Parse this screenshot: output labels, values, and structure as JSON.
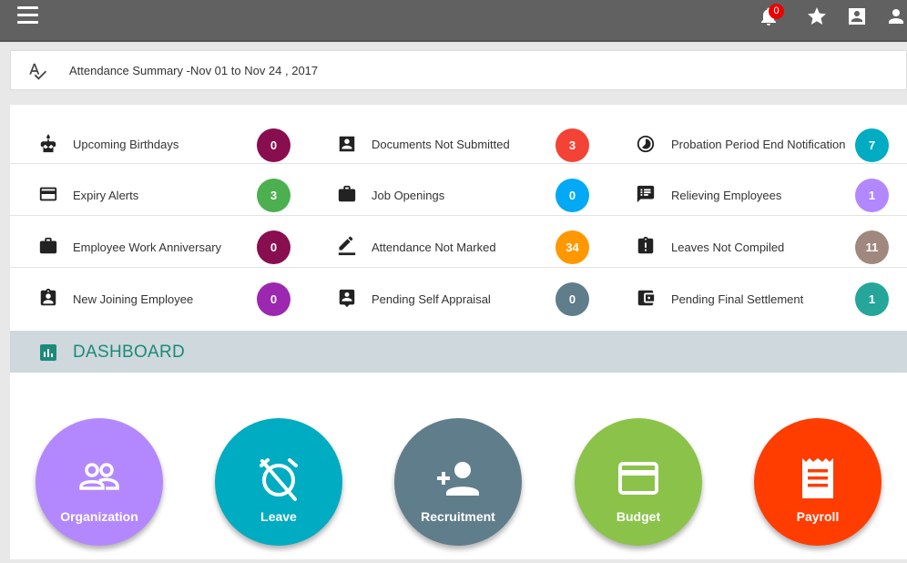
{
  "header": {
    "notification_count": "0",
    "icons": [
      "menu-icon",
      "bell-icon",
      "star-icon",
      "contact-card-icon",
      "user-icon"
    ]
  },
  "summary": {
    "title": "Attendance Summary -Nov 01 to Nov 24 , 2017",
    "icon": "spellcheck-icon"
  },
  "alerts": {
    "rows": [
      [
        {
          "label": "Upcoming Birthdays",
          "count": "0",
          "color": "#880e4f",
          "icon": "cake-icon"
        },
        {
          "label": "Documents Not Submitted",
          "count": "3",
          "color": "#f44336",
          "icon": "id-card-icon"
        },
        {
          "label": "Probation Period End Notification",
          "count": "7",
          "color": "#00acc1",
          "icon": "timelapse-icon"
        }
      ],
      [
        {
          "label": "Expiry Alerts",
          "count": "3",
          "color": "#4caf50",
          "icon": "credit-card-icon"
        },
        {
          "label": "Job Openings",
          "count": "0",
          "color": "#03a9f4",
          "icon": "briefcase-icon"
        },
        {
          "label": "Relieving Employees",
          "count": "1",
          "color": "#b388ff",
          "icon": "message-list-icon"
        }
      ],
      [
        {
          "label": "Employee Work Anniversary",
          "count": "0",
          "color": "#880e4f",
          "icon": "briefcase-icon"
        },
        {
          "label": "Attendance Not Marked",
          "count": "34",
          "color": "#ff9800",
          "icon": "edit-icon"
        },
        {
          "label": "Leaves Not Compiled",
          "count": "11",
          "color": "#a1887f",
          "icon": "clipboard-alert-icon"
        }
      ],
      [
        {
          "label": "New Joining Employee",
          "count": "0",
          "color": "#9c27b0",
          "icon": "clipboard-account-icon"
        },
        {
          "label": "Pending Self Appraisal",
          "count": "0",
          "color": "#607d8b",
          "icon": "account-box-icon"
        },
        {
          "label": "Pending Final Settlement",
          "count": "1",
          "color": "#26a69a",
          "icon": "wallet-icon"
        }
      ]
    ]
  },
  "dashboard": {
    "title": "DASHBOARD",
    "icon": "bar-chart-icon",
    "tiles": [
      {
        "label": "Organization",
        "color": "#b388ff",
        "icon": "people-icon"
      },
      {
        "label": "Leave",
        "color": "#00acc1",
        "icon": "alarm-off-icon"
      },
      {
        "label": "Recruitment",
        "color": "#607d8b",
        "icon": "person-add-icon"
      },
      {
        "label": "Budget",
        "color": "#8bc34a",
        "icon": "credit-card-icon"
      },
      {
        "label": "Payroll",
        "color": "#ff3d00",
        "icon": "receipt-icon"
      }
    ]
  }
}
